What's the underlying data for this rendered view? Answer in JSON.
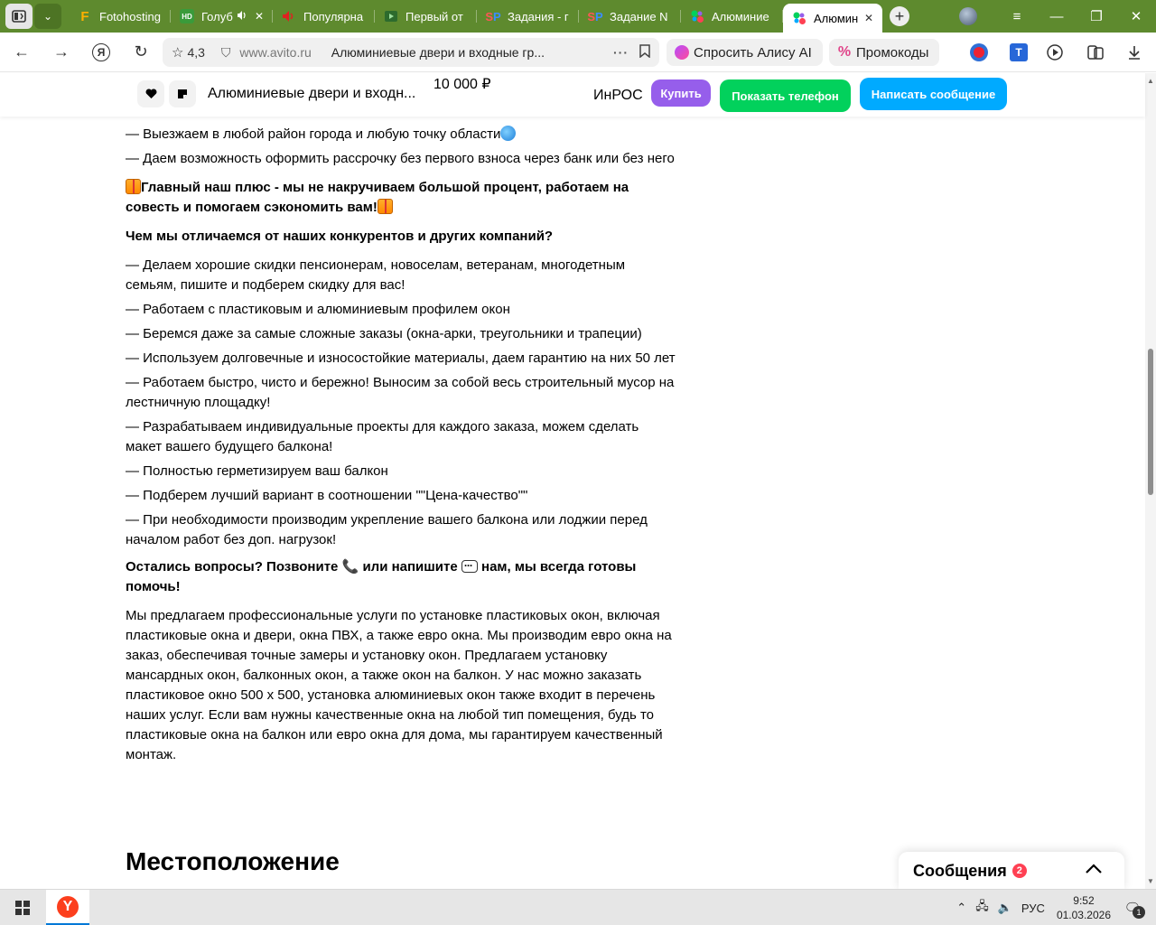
{
  "browser": {
    "tabs": [
      {
        "title": "Fotohosting",
        "favicon": "F",
        "fav_color": "#ffb000",
        "fav_text_color": "#ffb000"
      },
      {
        "title": "Голуб",
        "favicon": "HD",
        "fav_color": "#3a9b3a",
        "fav_text_color": "#ffffff",
        "audio": true
      },
      {
        "title": "Популярна",
        "favicon": "speaker",
        "fav_color": "#e02020",
        "fav_text_color": "#e02020"
      },
      {
        "title": "Первый от",
        "favicon": "video",
        "fav_color": "#2d6b2d",
        "fav_text_color": "#2d6b2d"
      },
      {
        "title": "Задания - г",
        "favicon": "SP",
        "fav_color": "#3a6ed6",
        "fav_text_color": "#ff4a4a"
      },
      {
        "title": "Задание N",
        "favicon": "SP",
        "fav_color": "#3a6ed6",
        "fav_text_color": "#ff4a4a"
      },
      {
        "title": "Алюминие",
        "favicon": "avito",
        "fav_color": "#ffffff",
        "fav_text_color": "#ffffff"
      },
      {
        "title": "Алюмин",
        "favicon": "avito",
        "fav_color": "#ffffff",
        "fav_text_color": "#ffffff",
        "active": true
      }
    ],
    "address": {
      "rating": "4,3",
      "domain": "www.avito.ru",
      "page_title": "Алюминиевые двери и входные гр..."
    },
    "alice_label": "Спросить Алису AI",
    "promo_label": "Промокоды"
  },
  "sticky_bar": {
    "title": "Алюминиевые двери и входн...",
    "price": "10 000 ₽",
    "seller": "ИнРОС",
    "buy_label": "Купить",
    "phone_label": "Показать телефон",
    "message_label": "Написать сообщение"
  },
  "colors": {
    "buy": "#965eeb",
    "phone": "#02d15c",
    "message": "#00aaff",
    "tabstrip": "#5e8a2e"
  },
  "description": {
    "p1": "— Выезжаем в любой район города и любую точку области",
    "p2": "— Даем возможность оформить рассрочку без первого взноса через банк или без него",
    "plus": "Главный наш плюс - мы не накручиваем большой процент, работаем на совесть и помогаем сэкономить вам!",
    "diff_heading": "Чем мы отличаемся от наших конкурентов и других компаний?",
    "list": [
      "— Делаем хорошие скидки пенсионерам, новоселам, ветеранам, многодетным семьям, пишите и подберем скидку для вас!",
      "— Работаем с пластиковым и алюминиевым профилем окон",
      "— Беремся даже за самые сложные заказы (окна-арки, треугольники и трапеции)",
      "— Используем долговечные и износостойкие материалы, даем гарантию на них 50 лет",
      "— Работаем быстро, чисто и бережно! Выносим за собой весь строительный мусор на лестничную площадку!",
      "— Разрабатываем индивидуальные проекты для каждого заказа, можем сделать макет вашего будущего балкона!",
      "— Полностью герметизируем ваш балкон",
      "— Подберем лучший вариант в соотношении \"\"Цена-качество\"\"",
      "— При необходимости производим укрепление вашего балкона или лоджии перед началом работ без доп. нагрузок!"
    ],
    "questions_a": "Остались вопросы? Позвоните",
    "questions_b": "или напишите",
    "questions_c": "нам, мы всегда готовы помочь!",
    "seo": "Мы предлагаем профессиональные услуги по установке пластиковых окон, включая пластиковые окна и двери, окна ПВХ, а также евро окна. Мы производим евро окна на заказ, обеспечивая точные замеры и установку окон. Предлагаем установку мансардных окон, балконных окон, а также окон на балкон. У нас можно заказать пластиковое окно 500 х 500, установка алюминиевых окон также входит в перечень наших услуг. Если вам нужны качественные окна на любой тип помещения, будь то пластиковые окна на балкон или евро окна для дома, мы гарантируем качественный монтаж."
  },
  "location_heading": "Местоположение",
  "messages_widget": {
    "title": "Сообщения",
    "badge": "2"
  },
  "taskbar": {
    "language": "РУС",
    "time": "9:52",
    "date": "01.03.2026",
    "notifications": "1"
  }
}
